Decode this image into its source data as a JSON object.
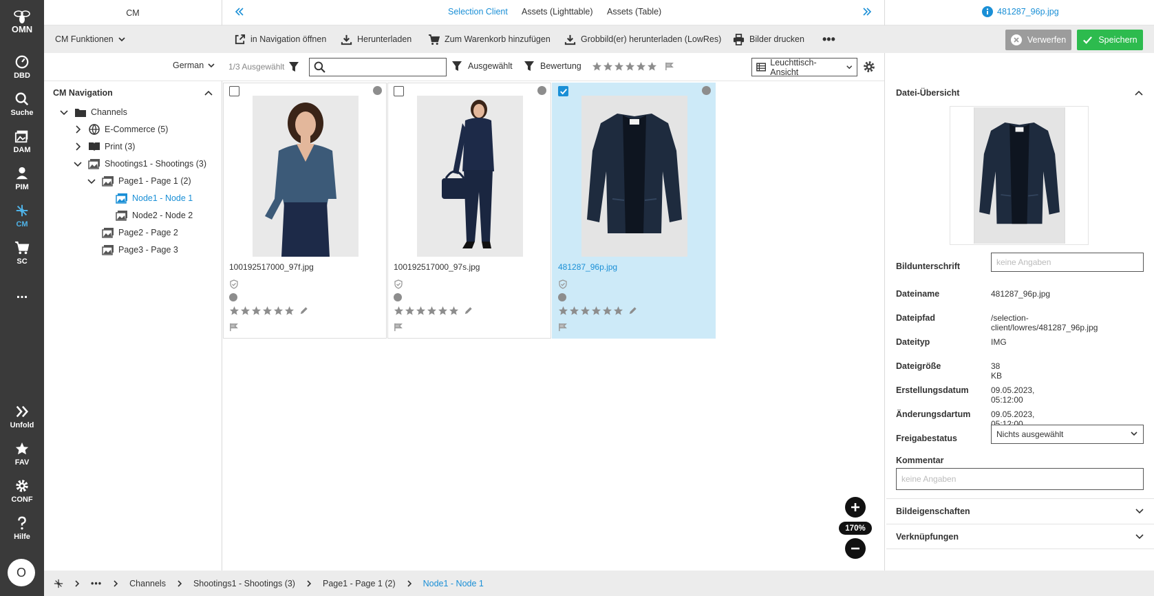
{
  "rail": {
    "logo": "OMN",
    "items": [
      "DBD",
      "Suche",
      "DAM",
      "PIM",
      "CM",
      "SC",
      "...",
      "Unfold",
      "FAV",
      "CONF",
      "Hilfe"
    ],
    "avatar": "O"
  },
  "header": {
    "left_title": "CM",
    "tabs": [
      "Selection Client",
      "Assets (Lighttable)",
      "Assets (Table)"
    ],
    "file_title": "481287_96p.jpg"
  },
  "toolbar": {
    "cm_funktionen": "CM Funktionen",
    "actions": [
      "in Navigation öffnen",
      "Herunterladen",
      "Zum Warenkorb hinzufügen",
      "Grobbild(er) herunterladen (LowRes)",
      "Bilder drucken"
    ],
    "discard": "Verwerfen",
    "save": "Speichern"
  },
  "filterbar": {
    "language": "German",
    "selected_count": "1/3 Ausgewählt",
    "search_placeholder": "",
    "filter_selected": "Ausgewählt",
    "filter_rating": "Bewertung",
    "view_mode": "Leuchttisch-Ansicht"
  },
  "navigation": {
    "title": "CM Navigation",
    "tree": [
      {
        "label": "Channels",
        "level": 0,
        "expanded": true,
        "icon": "folder-icon"
      },
      {
        "label": "E-Commerce (5)",
        "level": 1,
        "expanded": false,
        "icon": "globe-icon"
      },
      {
        "label": "Print (3)",
        "level": 1,
        "expanded": false,
        "icon": "book-icon"
      },
      {
        "label": "Shootings1 - Shootings (3)",
        "level": 1,
        "expanded": true,
        "icon": "image-icon"
      },
      {
        "label": "Page1 - Page 1 (2)",
        "level": 2,
        "expanded": true,
        "icon": "image-icon"
      },
      {
        "label": "Node1 - Node 1",
        "level": 3,
        "active": true,
        "icon": "image-icon"
      },
      {
        "label": "Node2 - Node 2",
        "level": 3,
        "icon": "image-icon"
      },
      {
        "label": "Page2 - Page 2",
        "level": 2,
        "icon": "image-icon"
      },
      {
        "label": "Page3 - Page 3",
        "level": 2,
        "icon": "image-icon"
      }
    ]
  },
  "assets": [
    {
      "filename": "100192517000_97f.jpg",
      "selected": false,
      "image": "woman-blouse"
    },
    {
      "filename": "100192517000_97s.jpg",
      "selected": false,
      "image": "woman-suit"
    },
    {
      "filename": "481287_96p.jpg",
      "selected": true,
      "image": "navy-jacket"
    }
  ],
  "zoom": {
    "level": "170%"
  },
  "details": {
    "section_title": "Datei-Übersicht",
    "fields": [
      {
        "label": "Bildunterschrift",
        "placeholder": "keine Angaben"
      },
      {
        "label": "Dateiname",
        "value": "481287_96p.jpg"
      },
      {
        "label": "Dateipfad",
        "value": "/selection-client/lowres/481287_96p.jpg"
      },
      {
        "label": "Dateityp",
        "value": "IMG"
      },
      {
        "label": "Dateigröße",
        "value": "38 KB"
      },
      {
        "label": "Erstellungsdatum",
        "value": "09.05.2023, 05:12:00"
      },
      {
        "label": "Änderungsdartum",
        "value": "09.05.2023, 05:12:00"
      },
      {
        "label": "Freigabestatus",
        "select": "Nichts ausgewählt"
      },
      {
        "label": "Kommentar",
        "placeholder": "keine Angaben"
      }
    ],
    "collapsed_sections": [
      "Bildeigenschaften",
      "Verknüpfungen"
    ]
  },
  "breadcrumb": [
    "Channels",
    "Shootings1 - Shootings (3)",
    "Page1 - Page 1 (2)",
    "Node1 - Node 1"
  ],
  "colors": {
    "accent": "#1a8fd6",
    "save": "#2dbb4e",
    "rail": "#3a3a3a",
    "selected_card": "#cdeaf8"
  }
}
